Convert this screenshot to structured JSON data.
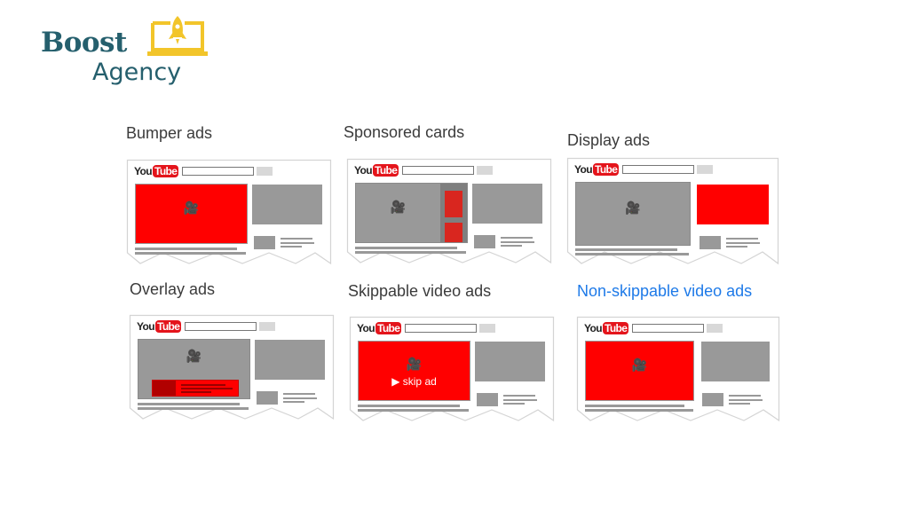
{
  "brand": {
    "name_line1": "Boost",
    "name_line2": "Agency",
    "icon": "rocket-laptop-icon",
    "colors": {
      "primary": "#255f6d",
      "accent": "#f2c52a"
    }
  },
  "youtube_logo": {
    "you": "You",
    "tube": "Tube"
  },
  "colors": {
    "ad_red": "#ff0000",
    "card_red": "#d9261f",
    "placeholder_gray": "#999999",
    "title_text": "#3b3b3b",
    "highlight_blue": "#1e7ae8"
  },
  "ad_formats": [
    {
      "id": "bumper",
      "title": "Bumper ads",
      "highlighted": false
    },
    {
      "id": "sponsored",
      "title": "Sponsored cards",
      "highlighted": false
    },
    {
      "id": "display",
      "title": "Display ads",
      "highlighted": false
    },
    {
      "id": "overlay",
      "title": "Overlay ads",
      "highlighted": false
    },
    {
      "id": "skippable",
      "title": "Skippable video ads",
      "highlighted": false,
      "overlay_text": "▶ skip ad"
    },
    {
      "id": "nonskippable",
      "title": "Non-skippable video ads",
      "highlighted": true
    }
  ],
  "icons": {
    "camera": "🎥"
  }
}
